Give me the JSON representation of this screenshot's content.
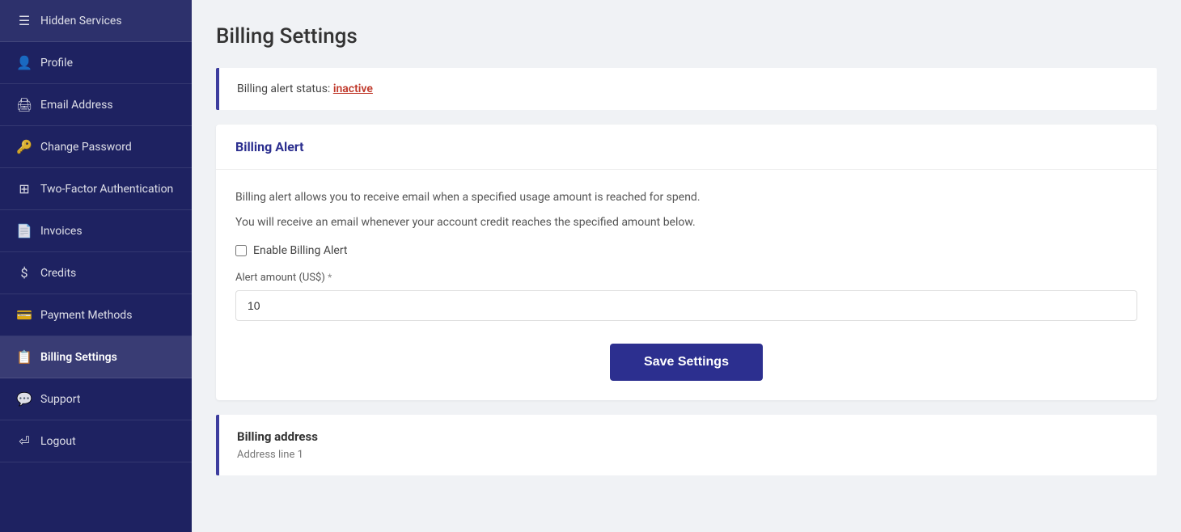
{
  "sidebar": {
    "items": [
      {
        "id": "hidden-services",
        "label": "Hidden Services",
        "icon": "☰",
        "active": false
      },
      {
        "id": "profile",
        "label": "Profile",
        "icon": "👤",
        "active": false
      },
      {
        "id": "email-address",
        "label": "Email Address",
        "icon": "🖨",
        "active": false
      },
      {
        "id": "change-password",
        "label": "Change Password",
        "icon": "🔑",
        "active": false
      },
      {
        "id": "two-factor",
        "label": "Two-Factor Authentication",
        "icon": "⊞",
        "active": false
      },
      {
        "id": "invoices",
        "label": "Invoices",
        "icon": "📄",
        "active": false
      },
      {
        "id": "credits",
        "label": "Credits",
        "icon": "$",
        "active": false
      },
      {
        "id": "payment-methods",
        "label": "Payment Methods",
        "icon": "💳",
        "active": false
      },
      {
        "id": "billing-settings",
        "label": "Billing Settings",
        "icon": "📋",
        "active": true
      },
      {
        "id": "support",
        "label": "Support",
        "icon": "💬",
        "active": false
      },
      {
        "id": "logout",
        "label": "Logout",
        "icon": "⏎",
        "active": false
      }
    ]
  },
  "page": {
    "title": "Billing Settings"
  },
  "status_card": {
    "prefix": "Billing alert status:",
    "status": "inactive"
  },
  "billing_alert_card": {
    "header": "Billing Alert",
    "desc1": "Billing alert allows you to receive email when a specified usage amount is reached for spend.",
    "desc2": "You will receive an email whenever your account credit reaches the specified amount below.",
    "checkbox_label": "Enable Billing Alert",
    "field_label": "Alert amount (US$)",
    "field_required": "*",
    "field_value": "10",
    "save_button": "Save Settings"
  },
  "billing_address": {
    "title": "Billing address",
    "sub": "Address line 1"
  }
}
